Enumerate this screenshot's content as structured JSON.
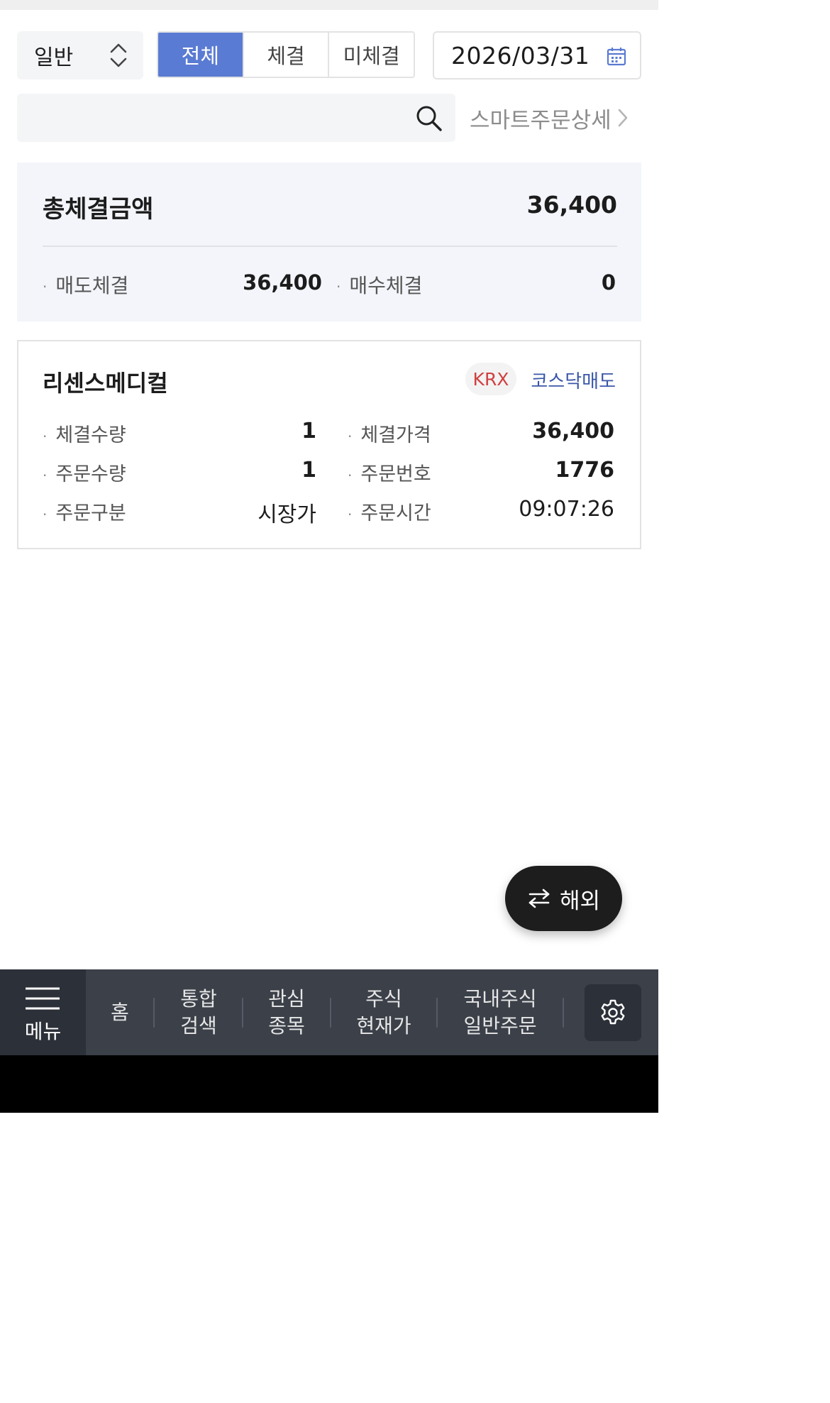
{
  "filters": {
    "type_select": "일반",
    "tabs": [
      {
        "label": "전체",
        "active": true
      },
      {
        "label": "체결",
        "active": false
      },
      {
        "label": "미체결",
        "active": false
      }
    ],
    "date": "2026/03/31"
  },
  "search": {
    "value": "",
    "placeholder": ""
  },
  "smart_order_link": "스마트주문상세",
  "summary": {
    "title": "총체결금액",
    "total": "36,400",
    "sell_label": "매도체결",
    "sell_value": "36,400",
    "buy_label": "매수체결",
    "buy_value": "0"
  },
  "order": {
    "stock_name": "리센스메디컬",
    "market_badge": "KRX",
    "side": "코스닥매도",
    "fields": {
      "filled_qty_label": "체결수량",
      "filled_qty": "1",
      "filled_price_label": "체결가격",
      "filled_price": "36,400",
      "order_qty_label": "주문수량",
      "order_qty": "1",
      "order_no_label": "주문번호",
      "order_no": "1776",
      "order_type_label": "주문구분",
      "order_type": "시장가",
      "order_time_label": "주문시간",
      "order_time": "09:07:26"
    }
  },
  "fab": {
    "label": "해외",
    "icon": "swap-arrows-icon"
  },
  "bottom_nav": {
    "menu_label": "메뉴",
    "items": [
      {
        "label": "홈"
      },
      {
        "label": "통합\n검색"
      },
      {
        "label": "관심\n종목"
      },
      {
        "label": "주식\n현재가"
      },
      {
        "label": "국내주식\n일반주문"
      }
    ],
    "settings_icon": "gear-icon"
  },
  "colors": {
    "accent": "#5a7bd3",
    "summary_bg": "#f3f5fa",
    "sell_blue": "#3a56a8",
    "krx_red": "#d04040",
    "nav_bg": "#3b4049"
  }
}
